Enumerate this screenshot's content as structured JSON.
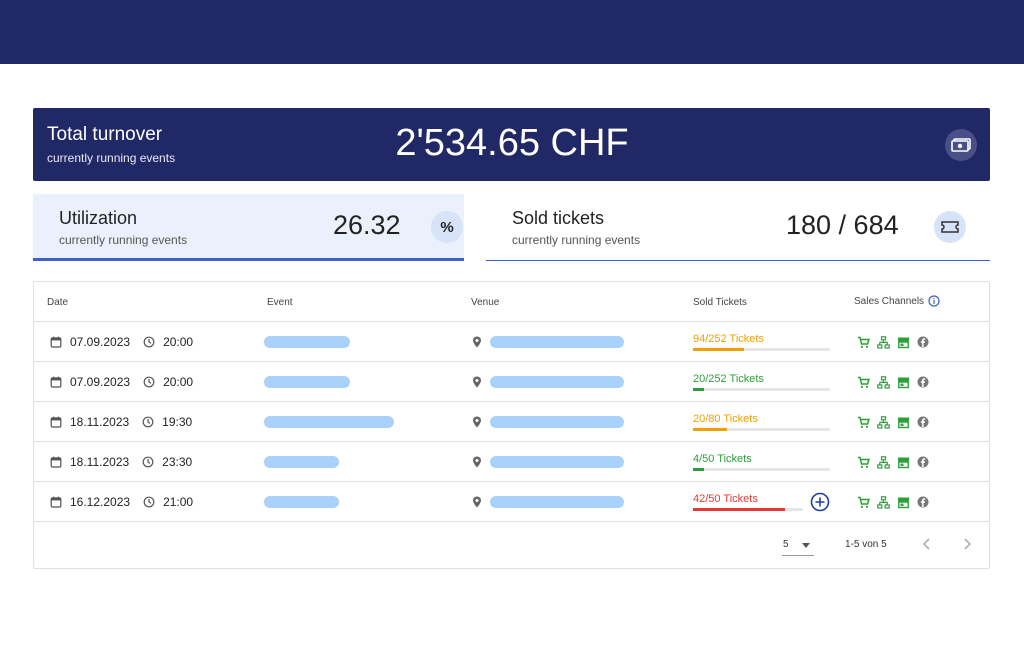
{
  "turnover": {
    "title": "Total turnover",
    "subtitle": "currently running events",
    "amount": "2'534.65 CHF",
    "icon": "money-icon"
  },
  "utilization": {
    "title": "Utilization",
    "subtitle": "currently running events",
    "value": "26.32",
    "icon": "percent-icon"
  },
  "sold": {
    "title": "Sold tickets",
    "subtitle": "currently running events",
    "value": "180 / 684",
    "icon": "ticket-icon"
  },
  "table": {
    "headers": {
      "date": "Date",
      "event": "Event",
      "venue": "Venue",
      "sold": "Sold Tickets",
      "channels": "Sales Channels"
    },
    "rows": [
      {
        "date": "07.09.2023",
        "time": "20:00",
        "tickets": "94/252 Tickets",
        "fill": 0.373,
        "status": "warning",
        "event_placeholder_len": 0.66,
        "venue_placeholder_len": 1.0
      },
      {
        "date": "07.09.2023",
        "time": "20:00",
        "tickets": "20/252 Tickets",
        "fill": 0.079,
        "status": "ok",
        "event_placeholder_len": 0.66,
        "venue_placeholder_len": 1.0
      },
      {
        "date": "18.11.2023",
        "time": "19:30",
        "tickets": "20/80 Tickets",
        "fill": 0.25,
        "status": "warning",
        "event_placeholder_len": 1.0,
        "venue_placeholder_len": 1.0
      },
      {
        "date": "18.11.2023",
        "time": "23:30",
        "tickets": "4/50 Tickets",
        "fill": 0.08,
        "status": "ok",
        "event_placeholder_len": 0.58,
        "venue_placeholder_len": 1.0
      },
      {
        "date": "16.12.2023",
        "time": "21:00",
        "tickets": "42/50 Tickets",
        "fill": 0.84,
        "status": "danger",
        "event_placeholder_len": 0.58,
        "venue_placeholder_len": 1.0,
        "add_button": true
      }
    ]
  },
  "pagination": {
    "page_size": "5",
    "range": "1-5 von 5"
  },
  "colors": {
    "brand": "#212866",
    "accent": "#3a63c7",
    "ok": "#2e9e3a",
    "warning": "#f0a000",
    "danger": "#e53935",
    "placeholder": "#a9d1f9"
  }
}
